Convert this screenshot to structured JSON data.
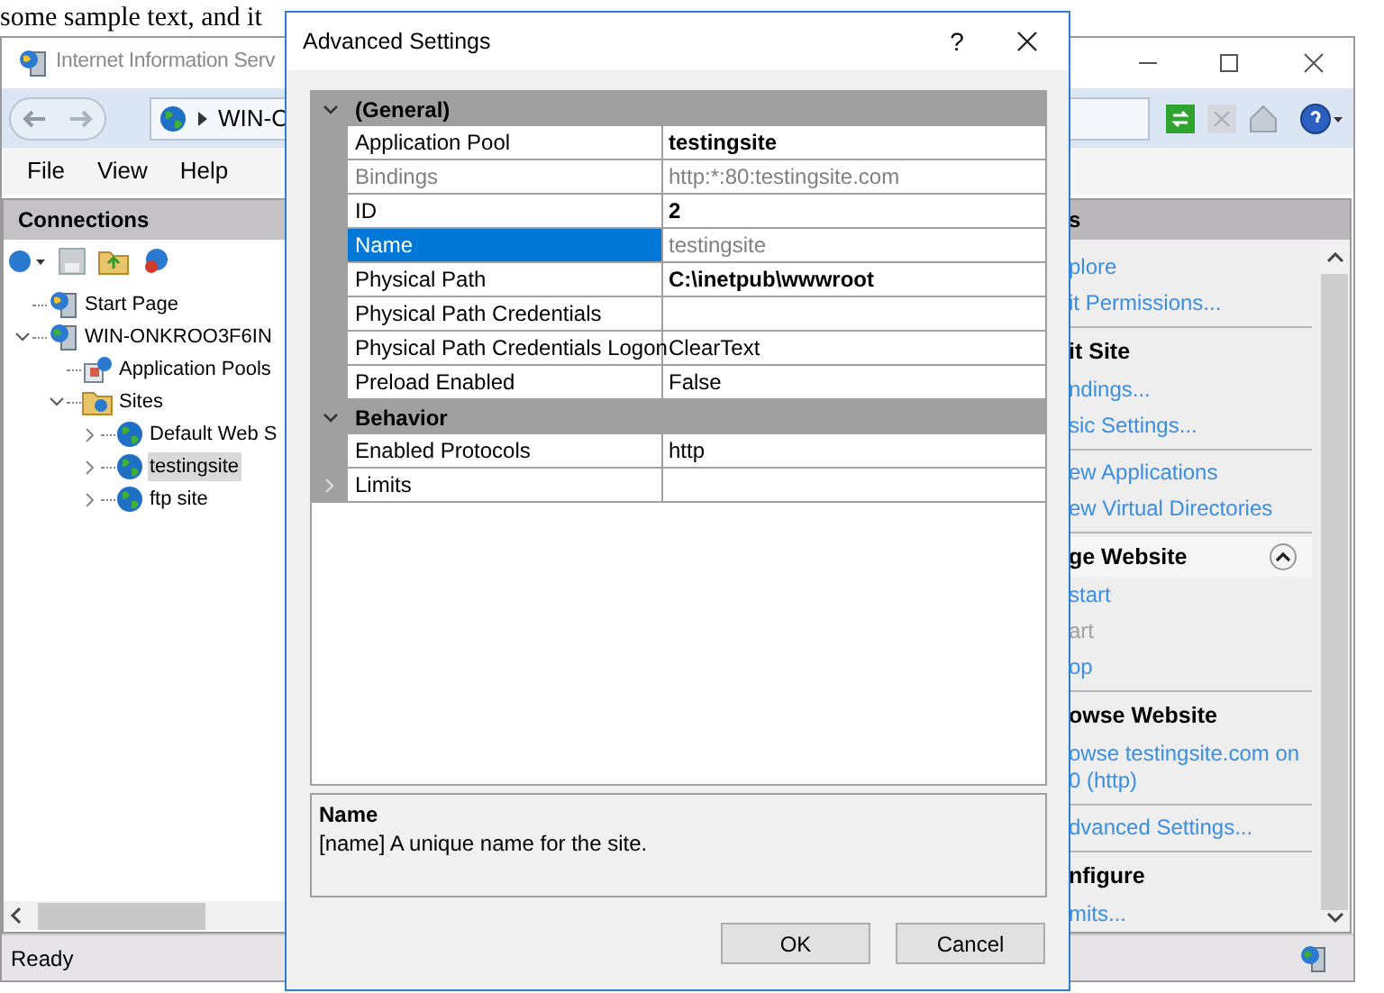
{
  "background_text": "some sample text, and it",
  "main_window": {
    "title": "Internet Information Serv",
    "address": "WIN-O",
    "menu": [
      "File",
      "View",
      "Help"
    ],
    "connections": {
      "title": "Connections",
      "tree": [
        {
          "kind": "page",
          "label": "Start Page",
          "selected": false
        },
        {
          "kind": "server",
          "label": "WIN-ONKROO3F6IN",
          "selected": false,
          "expanded": true,
          "children": [
            {
              "kind": "pools",
              "label": "Application Pools",
              "selected": false
            },
            {
              "kind": "folder",
              "label": "Sites",
              "selected": false,
              "expanded": true,
              "children": [
                {
                  "kind": "site",
                  "label": "Default Web S",
                  "selected": false,
                  "expanded": false
                },
                {
                  "kind": "site",
                  "label": "testingsite",
                  "selected": true,
                  "expanded": false
                },
                {
                  "kind": "site",
                  "label": "ftp site",
                  "selected": false,
                  "expanded": false
                }
              ]
            }
          ]
        }
      ]
    },
    "actions": {
      "title": "s",
      "sections": [
        {
          "items": [
            {
              "label": "plore",
              "disabled": false
            },
            {
              "label": "it Permissions...",
              "disabled": false
            }
          ]
        },
        {
          "heading": "it Site",
          "items": [
            {
              "label": "ndings...",
              "disabled": false
            },
            {
              "label": "sic Settings...",
              "disabled": false
            }
          ]
        },
        {
          "items": [
            {
              "label": "ew Applications",
              "disabled": false
            },
            {
              "label": "ew Virtual Directories",
              "disabled": false
            }
          ]
        },
        {
          "heading": "ge Website",
          "expanded": true,
          "items": [
            {
              "label": "start",
              "disabled": false
            },
            {
              "label": "art",
              "disabled": true
            },
            {
              "label": "op",
              "disabled": false
            }
          ]
        },
        {
          "heading": "owse Website",
          "items": [
            {
              "label": "owse testingsite.com on\n0 (http)",
              "disabled": false
            }
          ]
        },
        {
          "items": [
            {
              "label": "dvanced Settings...",
              "disabled": false
            }
          ]
        },
        {
          "heading": "nfigure",
          "items": [
            {
              "label": "mits...",
              "disabled": false
            }
          ]
        }
      ]
    },
    "status_bar": "Ready"
  },
  "dialog": {
    "title": "Advanced Settings",
    "help": "?",
    "property_grid": [
      {
        "label": "(General)",
        "expanded": true,
        "properties": [
          {
            "kind": "property",
            "name": "Application Pool",
            "value": "testingsite",
            "modified": true,
            "read_only": false,
            "selected": false
          },
          {
            "kind": "property",
            "name": "Bindings",
            "value": "http:*:80:testingsite.com",
            "modified": false,
            "read_only": true,
            "selected": false
          },
          {
            "kind": "property",
            "name": "ID",
            "value": "2",
            "modified": true,
            "read_only": false,
            "selected": false
          },
          {
            "kind": "property",
            "name": "Name",
            "value": "testingsite",
            "modified": false,
            "read_only": true,
            "selected": true
          },
          {
            "kind": "property",
            "name": "Physical Path",
            "value": "C:\\inetpub\\wwwroot",
            "modified": true,
            "read_only": false,
            "selected": false
          },
          {
            "kind": "property",
            "name": "Physical Path Credentials",
            "modified": false,
            "read_only": false,
            "selected": false
          },
          {
            "kind": "property",
            "name": "Physical Path Credentials Logon",
            "value": "ClearText",
            "modified": false,
            "read_only": false,
            "selected": false
          },
          {
            "kind": "property",
            "name": "Preload Enabled",
            "value": "False",
            "modified": false,
            "read_only": false,
            "selected": false
          }
        ]
      },
      {
        "label": "Behavior",
        "expanded": true,
        "properties": [
          {
            "kind": "property",
            "name": "Enabled Protocols",
            "value": "http",
            "modified": false,
            "read_only": false,
            "selected": false
          },
          {
            "kind": "expandable",
            "name": "Limits",
            "expanded": false,
            "modified": false,
            "read_only": false,
            "selected": false
          }
        ]
      }
    ],
    "description": {
      "title": "Name",
      "text": "[name] A unique name for the site."
    },
    "buttons": [
      "OK",
      "Cancel"
    ]
  }
}
